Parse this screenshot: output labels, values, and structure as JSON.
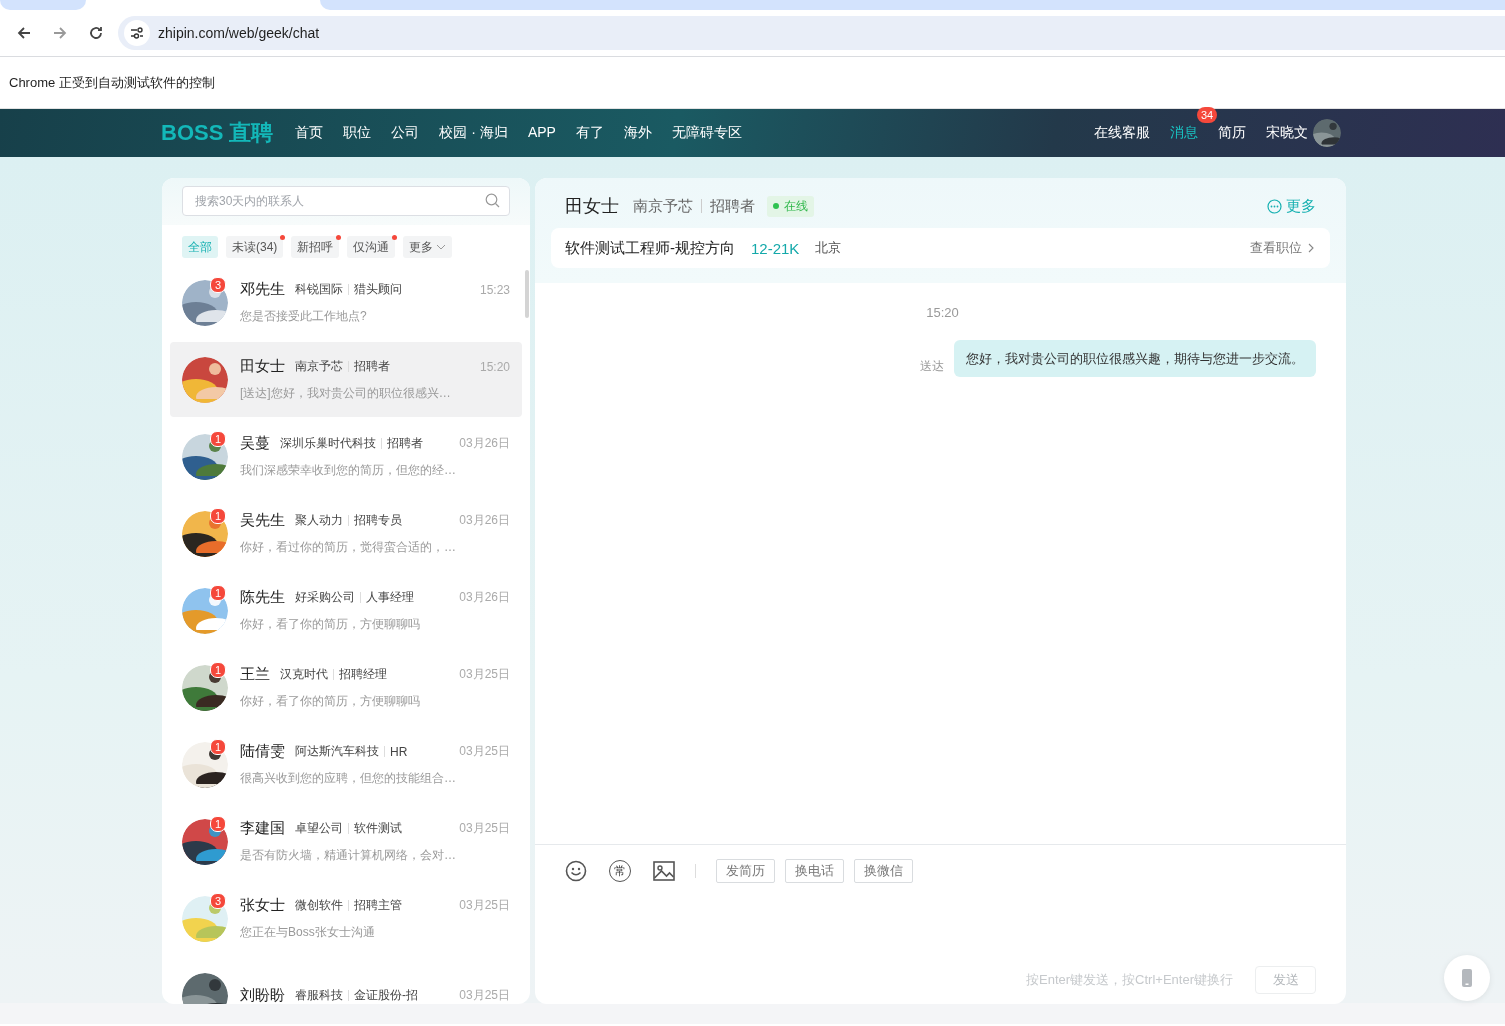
{
  "browser": {
    "url": "zhipin.com/web/geek/chat",
    "infobar": "Chrome 正受到自动测试软件的控制"
  },
  "header": {
    "logo": "BOSS 直聘",
    "nav": [
      {
        "label": "首页",
        "selected": false
      },
      {
        "label": "职位",
        "selected": false
      },
      {
        "label": "公司",
        "selected": false
      },
      {
        "label": "校园 · 海归",
        "selected": false
      },
      {
        "label": "APP",
        "selected": false
      },
      {
        "label": "有了",
        "selected": false
      },
      {
        "label": "海外",
        "selected": false
      },
      {
        "label": "无障碍专区",
        "selected": false
      }
    ],
    "right_nav": [
      {
        "label": "在线客服",
        "selected": false
      },
      {
        "label": "消息",
        "selected": true,
        "badge": "34"
      },
      {
        "label": "简历",
        "selected": false
      }
    ],
    "user": "宋晓文"
  },
  "contacts": {
    "search_placeholder": "搜索30天内的联系人",
    "filters": [
      {
        "label": "全部",
        "kind": "chip",
        "selected": true,
        "dot": false
      },
      {
        "label": "未读(34)",
        "kind": "chip",
        "selected": false,
        "dot": true
      },
      {
        "label": "新招呼",
        "kind": "chip",
        "selected": false,
        "dot": true
      },
      {
        "label": "仅沟通",
        "kind": "chip",
        "selected": false,
        "dot": true
      },
      {
        "label": "更多",
        "kind": "dropdown",
        "selected": false,
        "dot": false
      }
    ],
    "items": [
      {
        "name": "邓先生",
        "company": "科锐国际",
        "role": "猎头顾问",
        "time": "15:23",
        "preview": "您是否接受此工作地点?",
        "badge": "3",
        "selected": false
      },
      {
        "name": "田女士",
        "company": "南京予芯",
        "role": "招聘者",
        "time": "15:20",
        "preview": "[送达]您好，我对贵公司的职位很感兴…",
        "selected": true
      },
      {
        "name": "吴蔓",
        "company": "深圳乐巢时代科技",
        "role": "招聘者",
        "time": "03月26日",
        "preview": "我们深感荣幸收到您的简历，但您的经…",
        "badge": "1",
        "selected": false
      },
      {
        "name": "吴先生",
        "company": "聚人动力",
        "role": "招聘专员",
        "time": "03月26日",
        "preview": "你好，看过你的简历，觉得蛮合适的，…",
        "badge": "1",
        "selected": false
      },
      {
        "name": "陈先生",
        "company": "好采购公司",
        "role": "人事经理",
        "time": "03月26日",
        "preview": "你好，看了你的简历，方便聊聊吗",
        "badge": "1",
        "selected": false
      },
      {
        "name": "王兰",
        "company": "汉克时代",
        "role": "招聘经理",
        "time": "03月25日",
        "preview": "你好，看了你的简历，方便聊聊吗",
        "badge": "1",
        "selected": false
      },
      {
        "name": "陆倩雯",
        "company": "阿达斯汽车科技",
        "role": "HR",
        "time": "03月25日",
        "preview": "很高兴收到您的应聘，但您的技能组合…",
        "badge": "1",
        "selected": false
      },
      {
        "name": "李建国",
        "company": "卓望公司",
        "role": "软件测试",
        "time": "03月25日",
        "preview": "是否有防火墙，精通计算机网络，会对…",
        "badge": "1",
        "selected": false
      },
      {
        "name": "张女士",
        "company": "微创软件",
        "role": "招聘主管",
        "time": "03月25日",
        "preview": "您正在与Boss张女士沟通",
        "badge": "3",
        "selected": false
      },
      {
        "name": "刘盼盼",
        "company": "睿服科技",
        "role": "金证股份-招",
        "time": "03月25日",
        "selected": false
      }
    ]
  },
  "chat": {
    "name": "田女士",
    "company": "南京予芯",
    "role": "招聘者",
    "status": "在线",
    "more": "更多",
    "job": {
      "title": "软件测试工程师-规控方向",
      "salary": "12-21K",
      "city": "北京",
      "link": "查看职位"
    },
    "messages": [
      {
        "time": "15:20",
        "status": "送达",
        "text": "您好，我对贵公司的职位很感兴趣，期待与您进一步交流。"
      }
    ],
    "phrase_icon": "常",
    "actions": [
      "发简历",
      "换电话",
      "换微信"
    ],
    "hint": "按Enter键发送，按Ctrl+Enter键换行",
    "send": {
      "label": "发送",
      "disabled": true
    }
  }
}
